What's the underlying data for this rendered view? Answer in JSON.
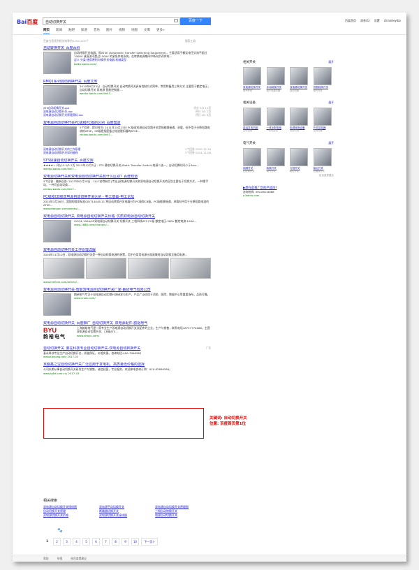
{
  "header": {
    "logo_left": "Bai",
    "logo_right": "百度",
    "query": "自动切换开关",
    "search_button": "百度一下",
    "links": [
      "百度首页",
      "消息(1)",
      "设置",
      "chinaheyibo"
    ]
  },
  "nav": {
    "tabs": [
      "网页",
      "新闻",
      "贴吧",
      "知道",
      "音乐",
      "图片",
      "视频",
      "地图",
      "文库",
      "更多»"
    ]
  },
  "stats": "百度为您找到相关结果约5,910,000个",
  "search_tools": "搜索工具",
  "results": [
    {
      "title": "自动转换开关_百度百科",
      "abstract": "自动转换开关电器，即ATSE (Automatic Transfer Switching Equipment)，主要适用于额定电压交流不超过1000V 或直流不超过1500V 的紧急供电系统，在转换电源期间中断向负荷供电...",
      "links": "定义  分类  使用原则  转换开关电器  机械类型",
      "url": "baike.baidu.com/"
    },
    {
      "title": "RMQ1系列自动转换开关_百度文库",
      "abstract": "2014年8月15日 - 自动切换开关 自动转换开关具有控制方式简单、常用和备用三种方式 主要用于额定电压，自动切换开关 双电源 智能控制器 ...",
      "url": "wenku.baidu.com/link?...",
      "subs": [
        {
          "t": "ATS自动切换开关.ppt",
          "d": "评分 3/5  12页"
        },
        {
          "t": "双电源自动切换开关.doc",
          "d": "评分 3/5  2页"
        },
        {
          "t": "双电源自动切换开关原理资料.doc",
          "d": "评分 4/5  6页"
        }
      ]
    },
    {
      "title": "双电源自动切换开关PC级和PC级的区别_百度知道",
      "abstract": "5个回答 - 提问时间: 2011年10月15日 PC级双电源自动切换开关是指能够接通、承载，但不用于分断短路电流的ATSE，CB级是指配备过电流脱扣器的ATSE...",
      "url": "zhidao.baidu.com/link?...",
      "subs": [
        {
          "t": "双电源自动切换开关的工作原理",
          "d": "1个回答  2010-12-30"
        },
        {
          "t": "双电源自动转换开关如何接线",
          "d": "3个回答  2014-11-08"
        }
      ]
    },
    {
      "title": "STS快速自动切换开关_百度文库",
      "abstract": "★★★★☆ 评分:3.5/5 2页 2015年12月2日 - STS 静态切换开关(Static Transfer Switch)电源二选一，自动切换时间小于5ms...",
      "url": "wenku.baidu.com/link?..."
    },
    {
      "title": "双电源切换开关和双电源自动切换开关有什么区别?_百度知道",
      "abstract": "5个回答 - 最新回答: 2015年02月28日 - 10人觉得有用 [专业]双电源切换开关和双电源自动切换开关的区别主要在于切换方式，一种需手动，一种可自动切换...",
      "url": "zhidao.baidu.com/link?..."
    },
    {
      "title": "PC级和CB级双电源自动切换开关区别 - 电工基础-电工论坛",
      "abstract": "2014年3月26日 - 我国的国家标准GB/T14048.11 将自动转换开关电器分为PC级和CB级。PC级能够接通、承载但不用于分断短路电流的ATSE...",
      "url": "www.diangon.com/wenku/..."
    },
    {
      "title": "双电源自动切换开关_双电源自动切换开关价格_优质双电源自动切换开关",
      "abstract": "GOQ4-100A/4P双电源自动切换开关 切换开关 三相四线ATS PC级 额定电压:380V 额定电流:100A...",
      "url": "www.1688.com/chanpin/..."
    },
    {
      "title": "双电源自动切换开关工作原理详解",
      "abstract": "2016年11月10日 - 双电源自动切换开关是一种自动转换电源的装置，用于在常用电源出现故障时自动切换至备用电源...",
      "url": "www.meilele.com/article/..."
    },
    {
      "title": "双电源自动切换开关-智能双电源自动切换开关厂家-朗研电气有限公司",
      "abstract": "朗研电气专注于双电源自动切换开关研发与生产，产品广泛应用于消防、医院、数据中心等重要场所，品质可靠。",
      "url": "www.cnais.com/"
    },
    {
      "title": "双电源自动切换开关_百度推广_自动切换开关_双电源配件-韵裕电气",
      "abstract": "上海韵裕电气是一家专业生产双电源自动切换开关及配件的企业，生产与销售，联系电话18757770066，主营双电源自动切换开关、CB级ATS...",
      "url": "www.shbyu.com/"
    },
    {
      "title": "自动切换开关_要在科技专业自动切换开关-双电源自动转换开关",
      "abstract": "泰永科技专业生产自动切换开关，质量保证，价格实惠。咨询电话:400-7006363",
      "url": "www.taiyong.net/  2017-03"
    },
    {
      "title": "京都鑫之宝自动切换开关广泛应用于发电机、高质量低价格的选择",
      "abstract": "公司长期从事自动切换开关研发生产与销售，诚信经营，专业服务，欢迎来电咨询订购：010-82890584。",
      "url": "www.bjfzf.com.cn/  2017-03"
    }
  ],
  "ad_label": "广告",
  "highlight_note": [
    "关键词: 自动切换开关",
    "位置: 百度首页第1位"
  ],
  "byu_logo": {
    "t1": "BYU",
    "t2": "韵裕电气"
  },
  "related": {
    "heading": "相关搜索",
    "items": [
      "双电源自动切换开关接线图",
      "双电源手动切换开关",
      "双电源自动切换开关原理图",
      "自动切换开关原理",
      "断路器切换开关",
      "三相自动转换开关",
      "双电源切换开关价格",
      "双电源切换开关接线图",
      "电源自动切换开关"
    ]
  },
  "pager": {
    "pages": [
      "1",
      "2",
      "3",
      "4",
      "5",
      "6",
      "7",
      "8",
      "9",
      "10"
    ],
    "next": "下一页>"
  },
  "footer": [
    "帮助",
    "举报",
    "给百度提建议"
  ],
  "right": {
    "blocks": [
      {
        "title": "相关开关",
        "more": "展开",
        "cards": [
          {
            "n": "双电源切换开关",
            "s": "电气开关"
          },
          {
            "n": "手动转换开关",
            "s": "用于电源切换"
          },
          {
            "n": "双电源切换开关",
            "s": "自动切换"
          },
          {
            "n": "切断转换开关",
            "s": "电气开关"
          }
        ]
      },
      {
        "title": "相关设备",
        "more": "展开",
        "cards": [
          {
            "n": "柴油发电机组",
            "s": "发电设备"
          },
          {
            "n": "一体化配电柜",
            "s": "一体化配电"
          },
          {
            "n": "电源转换设备",
            "s": "电源切换"
          },
          {
            "n": "开关控制器",
            "s": "控制设备"
          }
        ]
      },
      {
        "title": "电气开关",
        "more": "展开",
        "cards": [
          {
            "n": "倒顺开关",
            "s": "正反转开关"
          },
          {
            "n": "转换开关",
            "s": "电气开关"
          },
          {
            "n": "行程开关",
            "s": "限位开关"
          },
          {
            "n": "接近开关",
            "s": "无触点开关"
          }
        ]
      }
    ],
    "feedback": "给百度提建议",
    "promo_title": "▶想在此推广您的产品吗?",
    "promo_text": "咨询热线: 400-800-8888",
    "promo_url": "e.baidu.com"
  }
}
